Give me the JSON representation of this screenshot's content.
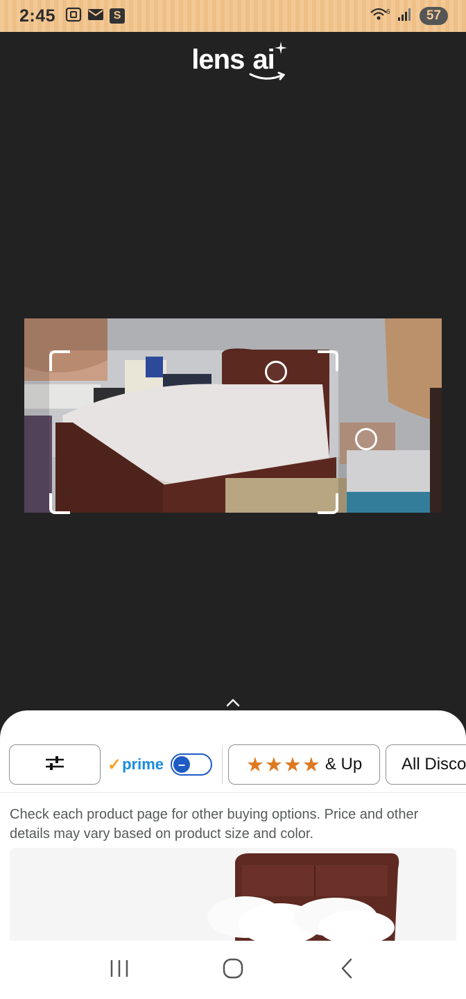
{
  "status_bar": {
    "time": "2:45",
    "s_badge": "S",
    "battery": "57",
    "wifi_sub": "6"
  },
  "header": {
    "logo_word1": "lens",
    "logo_word2": "ai"
  },
  "bottom_sheet": {
    "filters": {
      "prime_label": "prime",
      "prime_check": "✓",
      "prime_toggle": "off",
      "stars_glyphs": "★★★★",
      "stars_label": "& Up",
      "discount_label": "All Discounts"
    },
    "notice": "Check each product page for other buying options. Price and other details may vary based on product size and color."
  },
  "colors": {
    "background": "#222223",
    "status_bar": "#f2c996",
    "prime_blue": "#1a8cd8",
    "toggle_blue": "#1f5bc4",
    "star_orange": "#de7921"
  },
  "icons": [
    "screenshot-icon",
    "mail-icon",
    "wifi-icon",
    "signal-icon",
    "filter-sliders-icon",
    "chevron-up-icon",
    "recents-icon",
    "home-icon",
    "back-icon"
  ]
}
